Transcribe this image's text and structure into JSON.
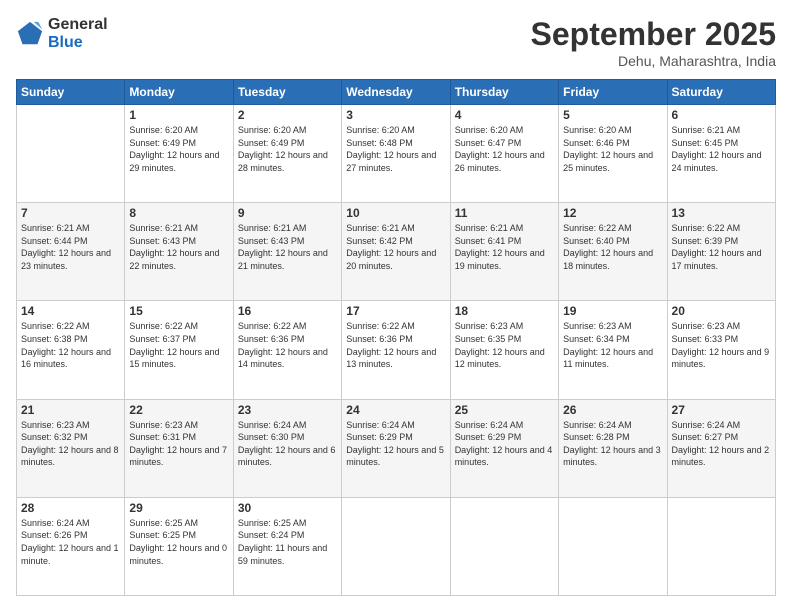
{
  "logo": {
    "general": "General",
    "blue": "Blue"
  },
  "header": {
    "month": "September 2025",
    "location": "Dehu, Maharashtra, India"
  },
  "weekdays": [
    "Sunday",
    "Monday",
    "Tuesday",
    "Wednesday",
    "Thursday",
    "Friday",
    "Saturday"
  ],
  "weeks": [
    [
      {
        "day": "",
        "sunrise": "",
        "sunset": "",
        "daylight": ""
      },
      {
        "day": "1",
        "sunrise": "Sunrise: 6:20 AM",
        "sunset": "Sunset: 6:49 PM",
        "daylight": "Daylight: 12 hours and 29 minutes."
      },
      {
        "day": "2",
        "sunrise": "Sunrise: 6:20 AM",
        "sunset": "Sunset: 6:49 PM",
        "daylight": "Daylight: 12 hours and 28 minutes."
      },
      {
        "day": "3",
        "sunrise": "Sunrise: 6:20 AM",
        "sunset": "Sunset: 6:48 PM",
        "daylight": "Daylight: 12 hours and 27 minutes."
      },
      {
        "day": "4",
        "sunrise": "Sunrise: 6:20 AM",
        "sunset": "Sunset: 6:47 PM",
        "daylight": "Daylight: 12 hours and 26 minutes."
      },
      {
        "day": "5",
        "sunrise": "Sunrise: 6:20 AM",
        "sunset": "Sunset: 6:46 PM",
        "daylight": "Daylight: 12 hours and 25 minutes."
      },
      {
        "day": "6",
        "sunrise": "Sunrise: 6:21 AM",
        "sunset": "Sunset: 6:45 PM",
        "daylight": "Daylight: 12 hours and 24 minutes."
      }
    ],
    [
      {
        "day": "7",
        "sunrise": "Sunrise: 6:21 AM",
        "sunset": "Sunset: 6:44 PM",
        "daylight": "Daylight: 12 hours and 23 minutes."
      },
      {
        "day": "8",
        "sunrise": "Sunrise: 6:21 AM",
        "sunset": "Sunset: 6:43 PM",
        "daylight": "Daylight: 12 hours and 22 minutes."
      },
      {
        "day": "9",
        "sunrise": "Sunrise: 6:21 AM",
        "sunset": "Sunset: 6:43 PM",
        "daylight": "Daylight: 12 hours and 21 minutes."
      },
      {
        "day": "10",
        "sunrise": "Sunrise: 6:21 AM",
        "sunset": "Sunset: 6:42 PM",
        "daylight": "Daylight: 12 hours and 20 minutes."
      },
      {
        "day": "11",
        "sunrise": "Sunrise: 6:21 AM",
        "sunset": "Sunset: 6:41 PM",
        "daylight": "Daylight: 12 hours and 19 minutes."
      },
      {
        "day": "12",
        "sunrise": "Sunrise: 6:22 AM",
        "sunset": "Sunset: 6:40 PM",
        "daylight": "Daylight: 12 hours and 18 minutes."
      },
      {
        "day": "13",
        "sunrise": "Sunrise: 6:22 AM",
        "sunset": "Sunset: 6:39 PM",
        "daylight": "Daylight: 12 hours and 17 minutes."
      }
    ],
    [
      {
        "day": "14",
        "sunrise": "Sunrise: 6:22 AM",
        "sunset": "Sunset: 6:38 PM",
        "daylight": "Daylight: 12 hours and 16 minutes."
      },
      {
        "day": "15",
        "sunrise": "Sunrise: 6:22 AM",
        "sunset": "Sunset: 6:37 PM",
        "daylight": "Daylight: 12 hours and 15 minutes."
      },
      {
        "day": "16",
        "sunrise": "Sunrise: 6:22 AM",
        "sunset": "Sunset: 6:36 PM",
        "daylight": "Daylight: 12 hours and 14 minutes."
      },
      {
        "day": "17",
        "sunrise": "Sunrise: 6:22 AM",
        "sunset": "Sunset: 6:36 PM",
        "daylight": "Daylight: 12 hours and 13 minutes."
      },
      {
        "day": "18",
        "sunrise": "Sunrise: 6:23 AM",
        "sunset": "Sunset: 6:35 PM",
        "daylight": "Daylight: 12 hours and 12 minutes."
      },
      {
        "day": "19",
        "sunrise": "Sunrise: 6:23 AM",
        "sunset": "Sunset: 6:34 PM",
        "daylight": "Daylight: 12 hours and 11 minutes."
      },
      {
        "day": "20",
        "sunrise": "Sunrise: 6:23 AM",
        "sunset": "Sunset: 6:33 PM",
        "daylight": "Daylight: 12 hours and 9 minutes."
      }
    ],
    [
      {
        "day": "21",
        "sunrise": "Sunrise: 6:23 AM",
        "sunset": "Sunset: 6:32 PM",
        "daylight": "Daylight: 12 hours and 8 minutes."
      },
      {
        "day": "22",
        "sunrise": "Sunrise: 6:23 AM",
        "sunset": "Sunset: 6:31 PM",
        "daylight": "Daylight: 12 hours and 7 minutes."
      },
      {
        "day": "23",
        "sunrise": "Sunrise: 6:24 AM",
        "sunset": "Sunset: 6:30 PM",
        "daylight": "Daylight: 12 hours and 6 minutes."
      },
      {
        "day": "24",
        "sunrise": "Sunrise: 6:24 AM",
        "sunset": "Sunset: 6:29 PM",
        "daylight": "Daylight: 12 hours and 5 minutes."
      },
      {
        "day": "25",
        "sunrise": "Sunrise: 6:24 AM",
        "sunset": "Sunset: 6:29 PM",
        "daylight": "Daylight: 12 hours and 4 minutes."
      },
      {
        "day": "26",
        "sunrise": "Sunrise: 6:24 AM",
        "sunset": "Sunset: 6:28 PM",
        "daylight": "Daylight: 12 hours and 3 minutes."
      },
      {
        "day": "27",
        "sunrise": "Sunrise: 6:24 AM",
        "sunset": "Sunset: 6:27 PM",
        "daylight": "Daylight: 12 hours and 2 minutes."
      }
    ],
    [
      {
        "day": "28",
        "sunrise": "Sunrise: 6:24 AM",
        "sunset": "Sunset: 6:26 PM",
        "daylight": "Daylight: 12 hours and 1 minute."
      },
      {
        "day": "29",
        "sunrise": "Sunrise: 6:25 AM",
        "sunset": "Sunset: 6:25 PM",
        "daylight": "Daylight: 12 hours and 0 minutes."
      },
      {
        "day": "30",
        "sunrise": "Sunrise: 6:25 AM",
        "sunset": "Sunset: 6:24 PM",
        "daylight": "Daylight: 11 hours and 59 minutes."
      },
      {
        "day": "",
        "sunrise": "",
        "sunset": "",
        "daylight": ""
      },
      {
        "day": "",
        "sunrise": "",
        "sunset": "",
        "daylight": ""
      },
      {
        "day": "",
        "sunrise": "",
        "sunset": "",
        "daylight": ""
      },
      {
        "day": "",
        "sunrise": "",
        "sunset": "",
        "daylight": ""
      }
    ]
  ]
}
